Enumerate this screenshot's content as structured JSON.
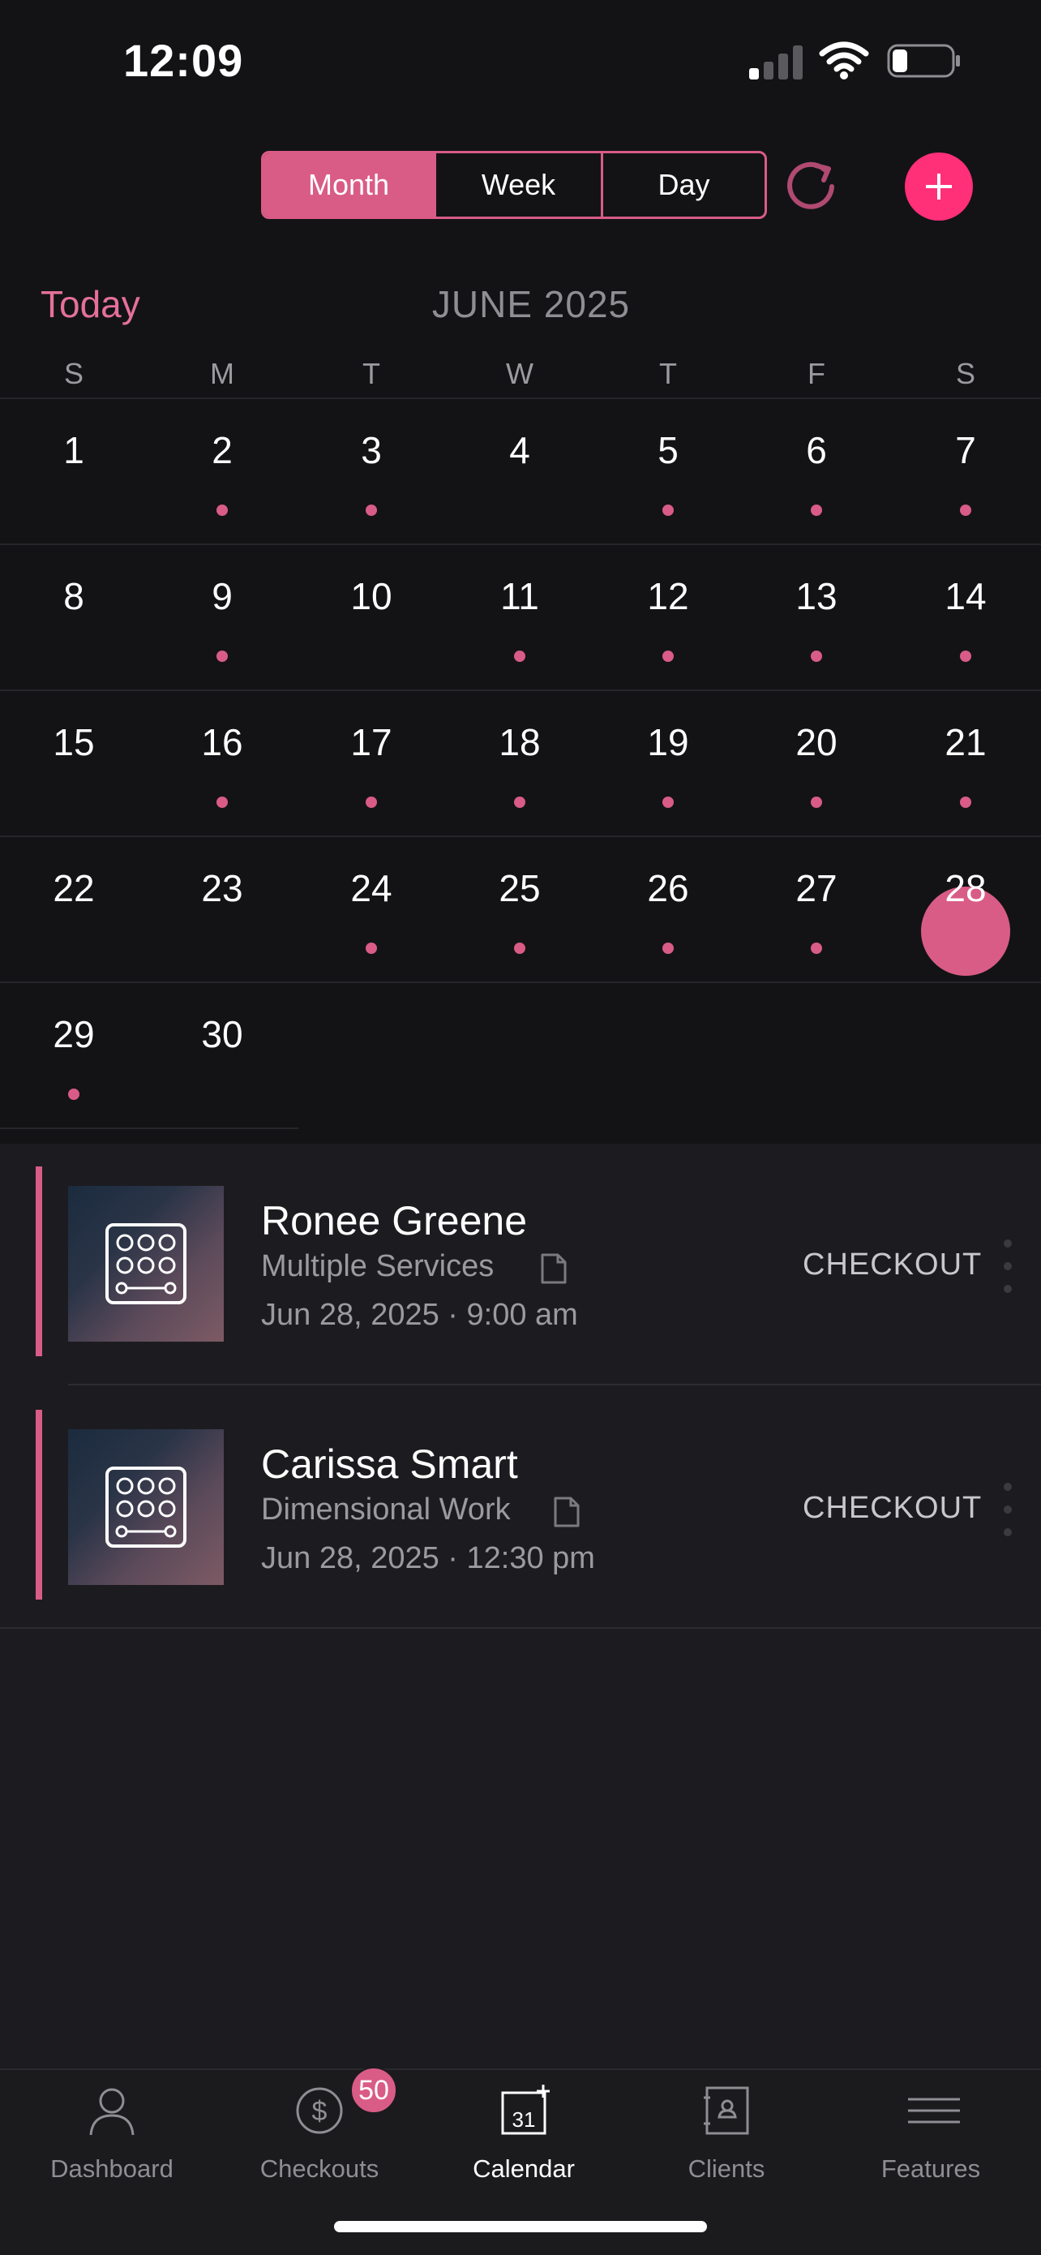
{
  "status": {
    "time": "12:09"
  },
  "view_switcher": {
    "month": "Month",
    "week": "Week",
    "day": "Day",
    "selected": "Month"
  },
  "header": {
    "today": "Today",
    "month_title": "JUNE 2025"
  },
  "weekdays": [
    "S",
    "M",
    "T",
    "W",
    "T",
    "F",
    "S"
  ],
  "calendar": {
    "selected_day": "28",
    "weeks": [
      [
        "1",
        "2",
        "3",
        "4",
        "5",
        "6",
        "7"
      ],
      [
        "8",
        "9",
        "10",
        "11",
        "12",
        "13",
        "14"
      ],
      [
        "15",
        "16",
        "17",
        "18",
        "19",
        "20",
        "21"
      ],
      [
        "22",
        "23",
        "24",
        "25",
        "26",
        "27",
        "28"
      ],
      [
        "29",
        "30"
      ]
    ],
    "days_with_appointments": [
      2,
      3,
      5,
      6,
      7,
      9,
      11,
      12,
      13,
      14,
      16,
      17,
      18,
      19,
      20,
      21,
      24,
      25,
      26,
      27,
      28,
      29
    ]
  },
  "appointments": [
    {
      "name": "Ronee Greene",
      "service": "Multiple Services",
      "datetime": "Jun 28, 2025 · 9:00 am",
      "action": "CHECKOUT"
    },
    {
      "name": "Carissa Smart",
      "service": "Dimensional Work",
      "datetime": "Jun 28, 2025 · 12:30 pm",
      "action": "CHECKOUT"
    }
  ],
  "tabs": {
    "dashboard": "Dashboard",
    "checkouts": "Checkouts",
    "calendar": "Calendar",
    "clients": "Clients",
    "features": "Features",
    "checkouts_badge": "50",
    "calendar_icon_day": "31"
  },
  "colors": {
    "accent": "#d95c86",
    "add_button": "#ff2f78",
    "background": "#131315",
    "list_background": "#1c1c20"
  }
}
